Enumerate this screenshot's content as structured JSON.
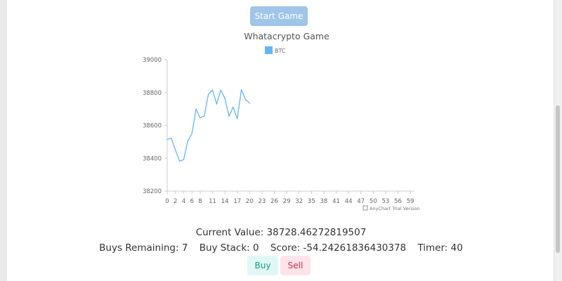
{
  "app": {
    "start_button_label": "Start Game"
  },
  "chart_data": {
    "type": "line",
    "title": "Whatacrypto Game",
    "legend_position": "top-center",
    "credit": "AnyChart Trial Version",
    "ylim": [
      38200,
      39000
    ],
    "y_ticks": [
      "38200",
      "38400",
      "38600",
      "38800",
      "39000"
    ],
    "xlim": [
      0,
      60
    ],
    "x_ticks": [
      "0",
      "2",
      "4",
      "6",
      "8",
      "11",
      "14",
      "17",
      "20",
      "23",
      "26",
      "29",
      "32",
      "35",
      "38",
      "41",
      "44",
      "47",
      "50",
      "53",
      "56",
      "59"
    ],
    "series": [
      {
        "name": "BTC",
        "color": "#64b5f6",
        "x": [
          0,
          1,
          2,
          3,
          4,
          5,
          6,
          7,
          8,
          9,
          10,
          11,
          12,
          13,
          14,
          15,
          16,
          17,
          18,
          19,
          20
        ],
        "values": [
          38515,
          38522,
          38450,
          38382,
          38392,
          38505,
          38550,
          38700,
          38645,
          38658,
          38790,
          38815,
          38730,
          38815,
          38765,
          38655,
          38712,
          38640,
          38818,
          38758,
          38735
        ]
      }
    ]
  },
  "stats": {
    "current_value": "Current Value: 38728.46272819507",
    "buys_remaining": "Buys Remaining: 7",
    "buy_stack": "Buy Stack: 0",
    "score": "Score: -54.24261836430378",
    "timer": "Timer: 40"
  },
  "actions": {
    "buy_label": "Buy",
    "sell_label": "Sell"
  }
}
